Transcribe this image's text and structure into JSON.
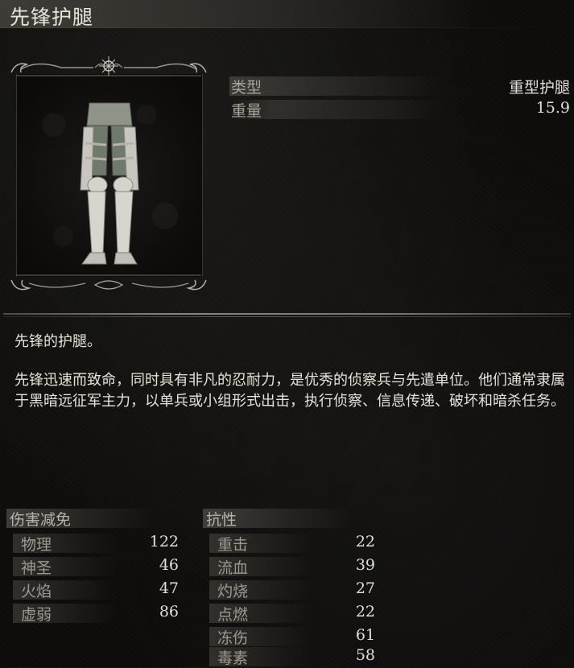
{
  "item": {
    "name": "先锋护腿",
    "icon": "vanguard-leggings-icon"
  },
  "attributes": [
    {
      "label": "类型",
      "value": "重型护腿"
    },
    {
      "label": "重量",
      "value": "15.9"
    }
  ],
  "description": {
    "summary": "先锋的护腿。",
    "lore": "先锋迅速而致命，同时具有非凡的忍耐力，是优秀的侦察兵与先遣单位。他们通常隶属于黑暗远征军主力，以单兵或小组形式出击，执行侦察、信息传递、破坏和暗杀任务。"
  },
  "damage_reduction": {
    "title": "伤害减免",
    "rows": [
      {
        "label": "物理",
        "value": "122"
      },
      {
        "label": "神圣",
        "value": "46"
      },
      {
        "label": "火焰",
        "value": "47"
      },
      {
        "label": "虚弱",
        "value": "86"
      }
    ]
  },
  "resistance": {
    "title": "抗性",
    "rows": [
      {
        "label": "重击",
        "value": "22"
      },
      {
        "label": "流血",
        "value": "39"
      },
      {
        "label": "灼烧",
        "value": "27"
      },
      {
        "label": "点燃",
        "value": "22"
      },
      {
        "label": "冻伤",
        "value": "61"
      },
      {
        "label": "毒素",
        "value": "58"
      }
    ]
  },
  "colors": {
    "background": "#0d0c0b",
    "text": "#e6e2d9",
    "muted_label": "#9e998f",
    "frame_metal": "#8b877e"
  }
}
